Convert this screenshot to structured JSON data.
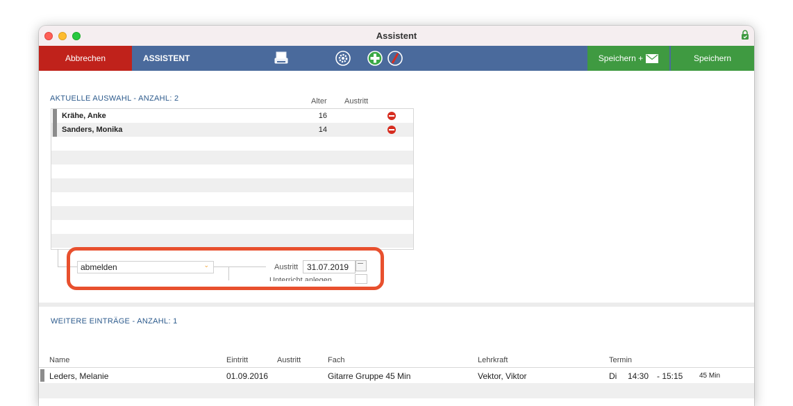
{
  "window": {
    "title": "Assistent"
  },
  "toolbar": {
    "cancel_label": "Abbrechen",
    "title": "ASSISTENT",
    "icons": [
      "printer-icon",
      "gear-icon",
      "add-icon",
      "remove-icon",
      "mail-icon"
    ],
    "save_mail_label": "Speichern +",
    "save_label": "Speichern",
    "colors": {
      "cancel": "#c0221b",
      "bar": "#4a6a9c",
      "save": "#3f9a41"
    }
  },
  "selection": {
    "title": "AKTUELLE AUSWAHL - ANZAHL: 2",
    "columns": {
      "age": "Alter",
      "exit": "Austritt"
    },
    "rows": [
      {
        "name": "Krähe, Anke",
        "age": "16"
      },
      {
        "name": "Sanders, Monika",
        "age": "14"
      }
    ]
  },
  "action": {
    "select_value": "abmelden",
    "exit_label": "Austritt",
    "exit_date": "31.07.2019",
    "hidden_label": "Unterricht anlegen"
  },
  "further": {
    "title": "WEITERE EINTRÄGE - ANZAHL: 1",
    "columns": {
      "name": "Name",
      "entry": "Eintritt",
      "exit": "Austritt",
      "subject": "Fach",
      "teacher": "Lehrkraft",
      "appointment": "Termin"
    },
    "rows": [
      {
        "name": "Leders, Melanie",
        "entry": "01.09.2016",
        "exit": "",
        "subject": "Gitarre Gruppe 45 Min",
        "teacher": "Vektor, Viktor",
        "day": "Di",
        "start": "14:30",
        "end": "- 15:15",
        "duration": "45 Min"
      }
    ]
  }
}
